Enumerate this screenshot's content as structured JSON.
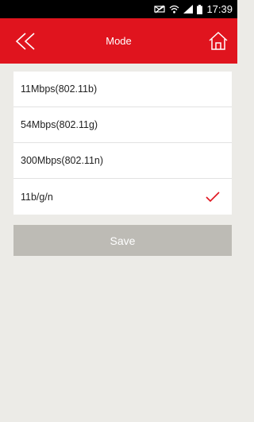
{
  "status_bar": {
    "time": "17:39",
    "icons": [
      "mute-icon",
      "wifi-icon",
      "signal-icon",
      "battery-icon"
    ]
  },
  "header": {
    "title": "Mode",
    "back_icon": "double-chevron-left-icon",
    "home_icon": "home-icon"
  },
  "modes": {
    "items": [
      {
        "label": "11Mbps(802.11b)",
        "selected": false
      },
      {
        "label": "54Mbps(802.11g)",
        "selected": false
      },
      {
        "label": "300Mbps(802.11n)",
        "selected": false
      },
      {
        "label": "11b/g/n",
        "selected": true
      }
    ]
  },
  "save_label": "Save",
  "colors": {
    "accent": "#e0141e",
    "background": "#ecebe7",
    "save_button": "#bdbbb5",
    "status_bar": "#000000"
  }
}
